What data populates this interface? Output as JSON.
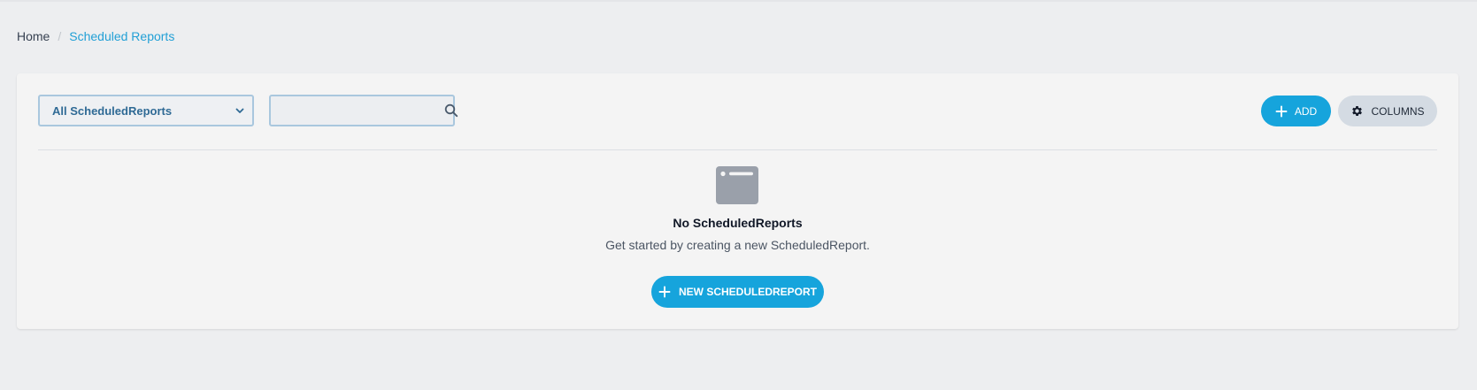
{
  "breadcrumb": {
    "home": "Home",
    "separator": "/",
    "current": "Scheduled Reports"
  },
  "toolbar": {
    "view_select_value": "All ScheduledReports",
    "view_select_icon": "chevron-down-icon",
    "search_value": "",
    "search_placeholder": "",
    "search_icon": "search-icon",
    "add_label": "ADD",
    "add_icon": "plus-icon",
    "columns_label": "COLUMNS",
    "columns_icon": "gear-icon"
  },
  "empty_state": {
    "icon": "window-icon",
    "title": "No ScheduledReports",
    "subtitle": "Get started by creating a new ScheduledReport.",
    "button_label": "NEW SCHEDULEDREPORT",
    "button_icon": "plus-icon"
  },
  "colors": {
    "accent": "#16a4dc",
    "link": "#22a0d6",
    "select_text": "#2f6a95",
    "page_bg": "#edeef0",
    "card_bg": "#f4f4f4",
    "secondary_button_bg": "#d4dbe3",
    "empty_icon": "#9aa0aa"
  }
}
